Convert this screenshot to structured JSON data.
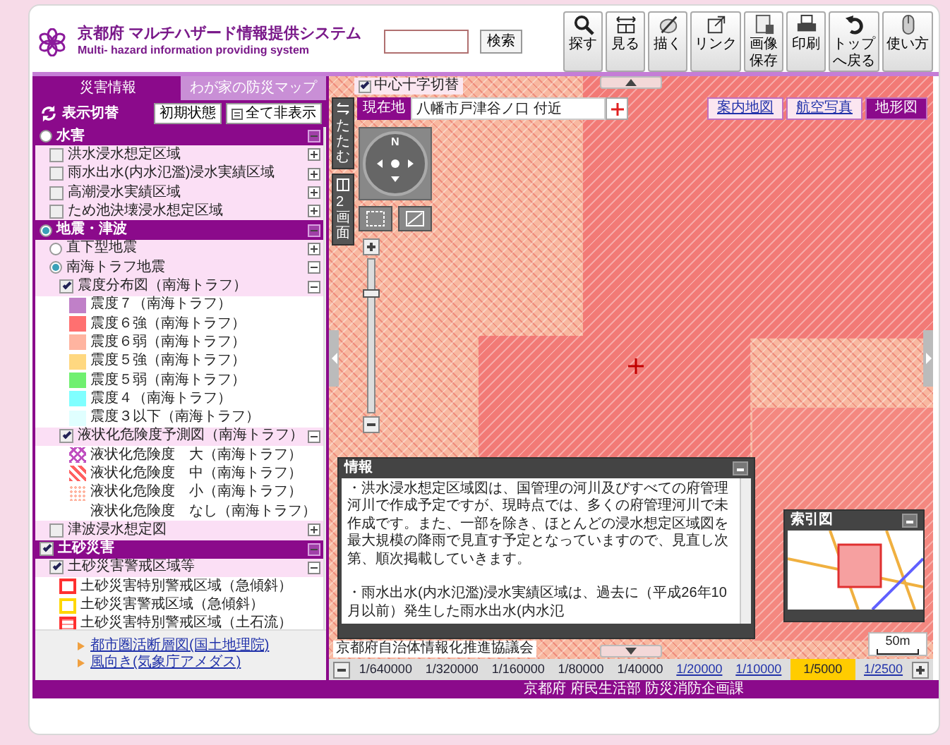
{
  "header": {
    "title": "京都府 マルチハザード情報提供システム",
    "subtitle": "Multi- hazard information providing system",
    "search_button": "検索",
    "tools": [
      {
        "label": "探す"
      },
      {
        "label": "見る"
      },
      {
        "label": "描く"
      },
      {
        "label": "リンク"
      },
      {
        "label": "画像保存"
      },
      {
        "label": "印刷"
      },
      {
        "label": "トップへ戻る"
      },
      {
        "label": "使い方"
      }
    ]
  },
  "sidebar": {
    "tabs": [
      {
        "label": "災害情報",
        "selected": true
      },
      {
        "label": "わが家の防災マップ",
        "selected": false
      }
    ],
    "toolbar": {
      "title": "表示切替",
      "buttons": [
        {
          "label": "初期状態",
          "kind": "plain"
        },
        {
          "label": "全て非表示",
          "kind": "list"
        }
      ]
    },
    "layers": [
      {
        "kind": "radio",
        "label": "水害",
        "selected": false,
        "expanded": true,
        "children": [
          {
            "kind": "checkbox",
            "label": "洪水浸水想定区域",
            "checked": false,
            "expanded": false
          },
          {
            "kind": "checkbox",
            "label": "雨水出水(内水氾濫)浸水実績区域",
            "checked": false,
            "expanded": false
          },
          {
            "kind": "checkbox",
            "label": "高潮浸水実績区域",
            "checked": false,
            "expanded": false
          },
          {
            "kind": "checkbox",
            "label": "ため池決壊浸水想定区域",
            "checked": false,
            "expanded": false
          }
        ]
      },
      {
        "kind": "radio",
        "label": "地震・津波",
        "selected": true,
        "expanded": true,
        "children": [
          {
            "kind": "radio",
            "label": "直下型地震",
            "selected": false,
            "expanded": false
          },
          {
            "kind": "radio",
            "label": "南海トラフ地震",
            "selected": true,
            "expanded": true,
            "children": [
              {
                "kind": "checkbox",
                "label": "震度分布図（南海トラフ）",
                "checked": true,
                "expanded": true,
                "children": [
                  {
                    "kind": "solid",
                    "label": "震度７（南海トラフ）",
                    "color": "#c080c8"
                  },
                  {
                    "kind": "solid",
                    "label": "震度６強（南海トラフ）",
                    "color": "#ff7070"
                  },
                  {
                    "kind": "solid",
                    "label": "震度６弱（南海トラフ）",
                    "color": "#ffb4a0"
                  },
                  {
                    "kind": "solid",
                    "label": "震度５強（南海トラフ）",
                    "color": "#ffd880"
                  },
                  {
                    "kind": "solid",
                    "label": "震度５弱（南海トラフ）",
                    "color": "#70f070"
                  },
                  {
                    "kind": "solid",
                    "label": "震度４（南海トラフ）",
                    "color": "#80ffff"
                  },
                  {
                    "kind": "solid",
                    "label": "震度３以下（南海トラフ）",
                    "color": "#e0ffff"
                  }
                ]
              },
              {
                "kind": "checkbox",
                "label": "液状化危険度予測図（南海トラフ）",
                "checked": true,
                "expanded": true,
                "children": [
                  {
                    "kind": "lattice",
                    "label": "液状化危険度　大（南海トラフ）",
                    "color": "#c050c0"
                  },
                  {
                    "kind": "stripe",
                    "label": "液状化危険度　中（南海トラフ）",
                    "color": "#ff6060"
                  },
                  {
                    "kind": "dots",
                    "label": "液状化危険度　小（南海トラフ）",
                    "color": "#ffb4a0"
                  },
                  {
                    "kind": "blank",
                    "label": "液状化危険度　なし（南海トラフ）"
                  }
                ]
              }
            ]
          },
          {
            "kind": "checkbox",
            "label": "津波浸水想定図",
            "checked": false,
            "expanded": false
          }
        ]
      },
      {
        "kind": "checkbox",
        "label": "土砂災害",
        "checked": true,
        "expanded": true,
        "children": [
          {
            "kind": "checkbox",
            "label": "土砂災害警戒区域等",
            "checked": true,
            "expanded": true,
            "children": [
              {
                "kind": "outline",
                "label": "土砂災害特別警戒区域（急傾斜）",
                "color": "#ff3030"
              },
              {
                "kind": "outline",
                "label": "土砂災害警戒区域（急傾斜）",
                "color": "#ffd700"
              },
              {
                "kind": "hatched",
                "label": "土砂災害特別警戒区域（土石流）",
                "color": "#ff3030"
              }
            ]
          }
        ]
      }
    ],
    "links": [
      {
        "label": "都市圏活断層図(国土地理院)"
      },
      {
        "label": "風向き(気象庁アメダス)"
      }
    ]
  },
  "map": {
    "crosshair_toggle": {
      "label": "中心十字切替",
      "checked": true
    },
    "location": {
      "label": "現在地",
      "value": "八幡市戸津谷ノ口 付近"
    },
    "side_buttons": [
      {
        "label": "たたむ"
      },
      {
        "label": "2画面"
      }
    ],
    "compass": {
      "north_label": "N"
    },
    "map_types": [
      {
        "label": "案内地図",
        "selected": false
      },
      {
        "label": "航空写真",
        "selected": false
      },
      {
        "label": "地形図",
        "selected": true
      }
    ],
    "zoom_slider": {
      "level": 0.8
    },
    "info_panel": {
      "title": "情報",
      "paragraphs": [
        "・洪水浸水想定区域図は、国管理の河川及びすべての府管理河川で作成予定ですが、現時点では、多くの府管理河川で未作成です。また、一部を除き、ほとんどの浸水想定区域図を最大規模の降雨で見直す予定となっていますので、見直し次第、順次掲載していきます。",
        "・雨水出水(内水氾濫)浸水実績区域は、過去に（平成26年10月以前）発生した雨水出水(内水氾"
      ]
    },
    "overview": {
      "title": "索引図"
    },
    "scale_bar": "50m",
    "copyright": "京都府自治体情報化推進協議会"
  },
  "scales": [
    {
      "label": "1/640000",
      "selected": false,
      "link": false
    },
    {
      "label": "1/320000",
      "selected": false,
      "link": false
    },
    {
      "label": "1/160000",
      "selected": false,
      "link": false
    },
    {
      "label": "1/80000",
      "selected": false,
      "link": false
    },
    {
      "label": "1/40000",
      "selected": false,
      "link": false
    },
    {
      "label": "1/20000",
      "selected": false,
      "link": true
    },
    {
      "label": "1/10000",
      "selected": false,
      "link": true
    },
    {
      "label": "1/5000",
      "selected": true,
      "link": false
    },
    {
      "label": "1/2500",
      "selected": false,
      "link": true
    }
  ],
  "footer": "京都府 府民生活部 防災消防企画課"
}
